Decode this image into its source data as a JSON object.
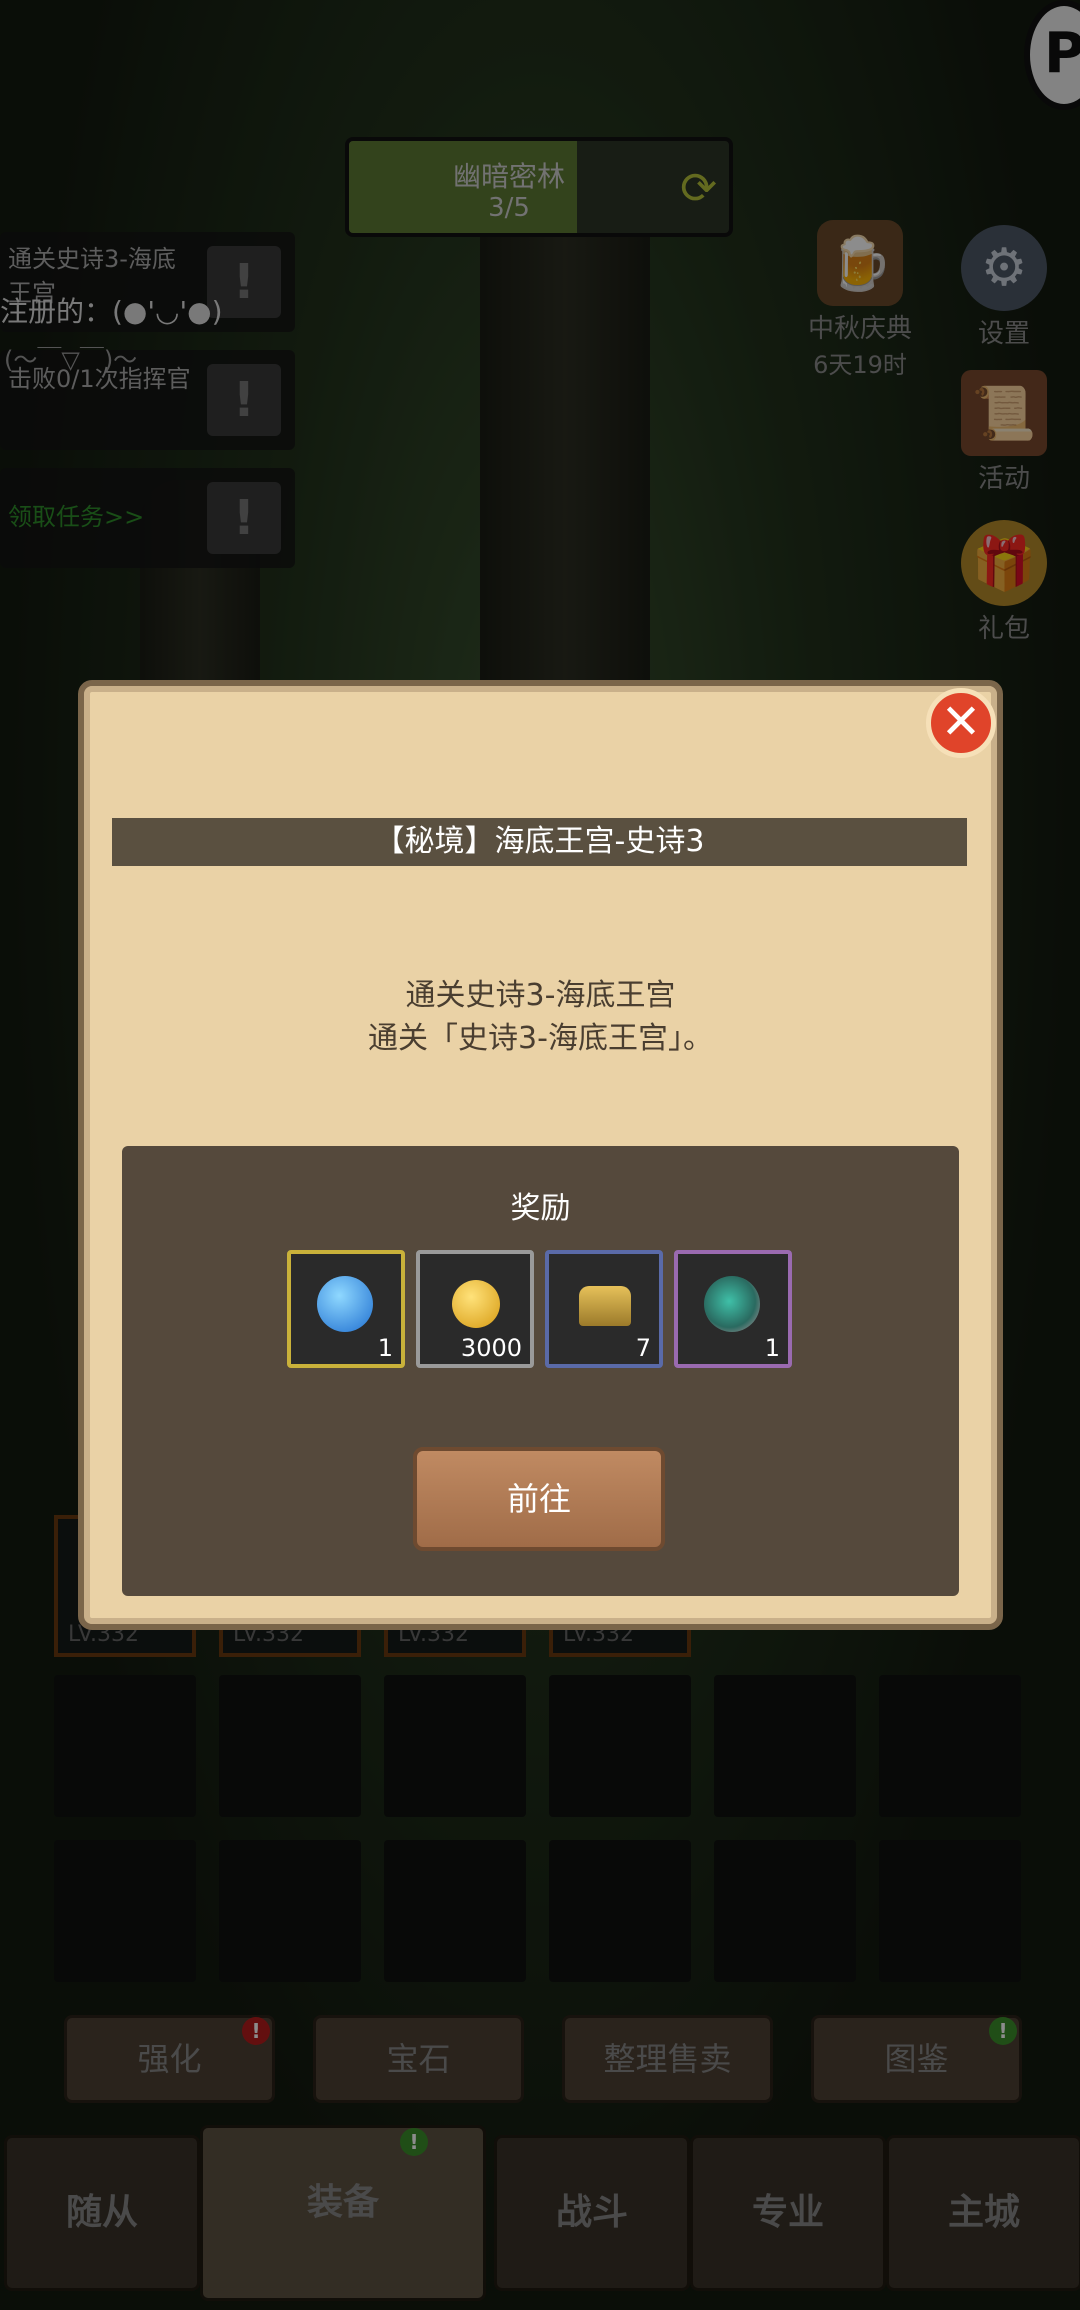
{
  "zone": {
    "name": "幽暗密林",
    "progress_text": "3/5",
    "progress_fraction": 0.6
  },
  "quests": [
    {
      "text": "通关史诗3-海底王宫",
      "button": "!"
    },
    {
      "text": "击败0/1次指挥官",
      "button": "!"
    },
    {
      "text": "领取任务>>",
      "button": "!"
    }
  ],
  "overlay": {
    "registered": "注册的：(●'◡'●)",
    "face": "(～￣▽￣)～"
  },
  "side_icons": {
    "event_title": "中秋庆典",
    "event_time": "6天19时",
    "settings": "设置",
    "activity": "活动",
    "gift": "礼包"
  },
  "equip_levels": [
    "LV.332",
    "LV.332",
    "LV.332",
    "LV.332"
  ],
  "sub_buttons": [
    "强化",
    "宝石",
    "整理售卖",
    "图鉴"
  ],
  "tabs": [
    "随从",
    "装备",
    "战斗",
    "专业",
    "主城"
  ],
  "dialog": {
    "title": "【秘境】海底王宫-史诗3",
    "desc_line1": "通关史诗3-海底王宫",
    "desc_line2": "通关「史诗3-海底王宫」。",
    "reward_title": "奖励",
    "rewards": [
      {
        "icon": "blue-token-icon",
        "count": "1",
        "border": "#c9b13a"
      },
      {
        "icon": "gold-coin-icon",
        "count": "3000",
        "border": "#9a9a9a"
      },
      {
        "icon": "helmet-icon",
        "count": "7",
        "border": "#5a6aa8"
      },
      {
        "icon": "gem-ore-icon",
        "count": "1",
        "border": "#9a6ab0"
      }
    ],
    "go_label": "前往",
    "close_label": "✕"
  },
  "corner": {
    "label": "P"
  }
}
